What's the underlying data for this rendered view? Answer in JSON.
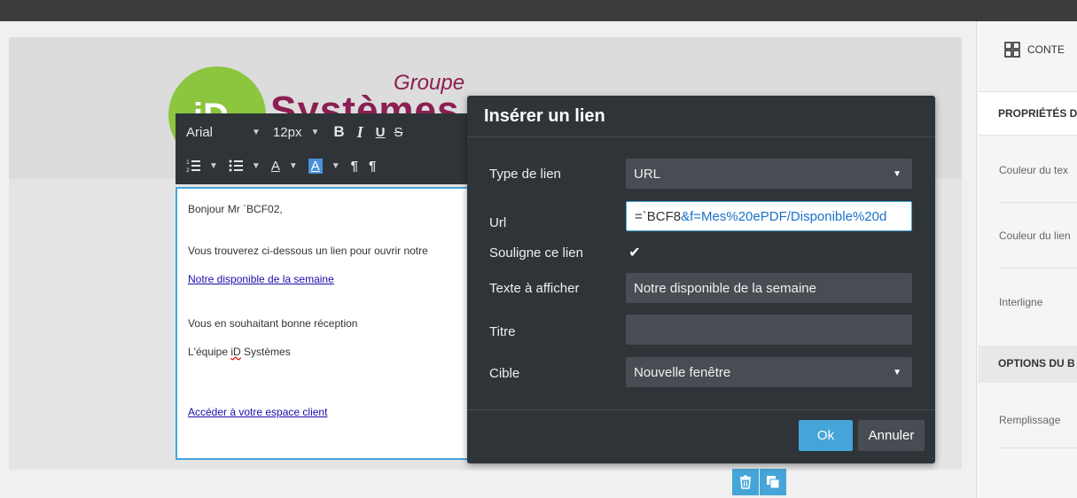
{
  "logo": {
    "groupe": "Groupe",
    "systemes": "Systèmes",
    "initials": "iD"
  },
  "toolbar": {
    "font": "Arial",
    "size": "12px",
    "bold": "B",
    "italic": "I",
    "underline": "U",
    "strike": "S",
    "text_color": "A",
    "bg_color": "A",
    "ltr": "¶",
    "rtl": "¶"
  },
  "email": {
    "greeting": "Bonjour Mr `BCF02,",
    "line1": "Vous trouverez ci-dessous un lien pour ouvrir notre",
    "link1": "Notre disponible de la semaine",
    "line2": "Vous en souhaitant bonne réception",
    "signature_pre": "L'équipe ",
    "signature_spell": "iD",
    "signature_post": " Systèmes",
    "link2": "Accéder à votre espace client"
  },
  "dialog": {
    "title": "Insérer un lien",
    "type_label": "Type de lien",
    "type_value": "URL",
    "url_label": "Url",
    "url_prefix": "=`BCF8",
    "url_selected": "&f=Mes%20ePDF/Disponible%20d",
    "underline_label": "Souligne ce lien",
    "underline_checked": true,
    "display_label": "Texte à afficher",
    "display_value": "Notre disponible de la semaine",
    "title_label": "Titre",
    "title_value": "",
    "target_label": "Cible",
    "target_value": "Nouvelle fenêtre",
    "ok": "Ok",
    "cancel": "Annuler"
  },
  "right_panel": {
    "header": "CONTE",
    "props_section": "PROPRIÉTÉS D",
    "text_color": "Couleur du tex",
    "link_color": "Couleur du lien",
    "line_height": "Interligne",
    "options_section": "OPTIONS DU B",
    "padding": "Remplissage"
  },
  "colors": {
    "accent": "#45a5d8",
    "dialog_bg": "#2f3438",
    "logo_green": "#8cc63f",
    "logo_brand": "#8b1e52"
  }
}
